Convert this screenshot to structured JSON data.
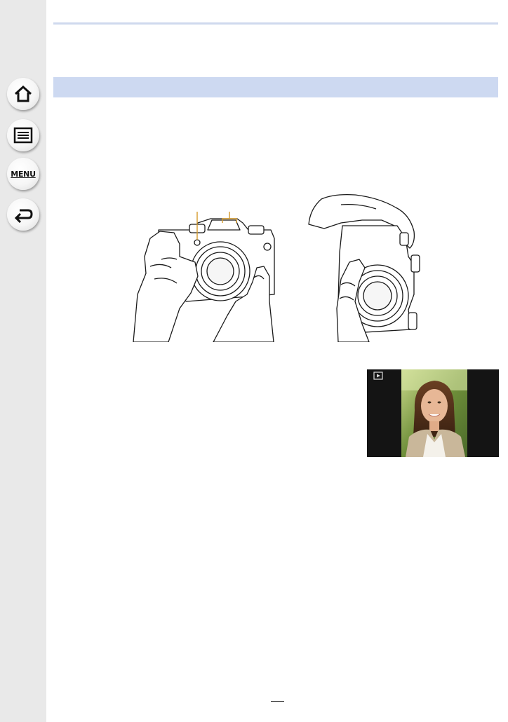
{
  "sidebar": {
    "buttons": [
      {
        "id": "home",
        "icon": "home-icon"
      },
      {
        "id": "contents",
        "icon": "list-icon"
      },
      {
        "id": "menu",
        "icon": "menu-icon",
        "label": "MENU"
      },
      {
        "id": "back",
        "icon": "back-arrow-icon"
      }
    ]
  },
  "colors": {
    "sidebar_bg": "#e9e9e9",
    "section_bar": "#cdd9f1",
    "top_rule": "#cfd9ee",
    "callout": "#d49a2a"
  },
  "illustrations": [
    {
      "name": "camera-held-horizontal",
      "icon": "hands-holding-camera-illustration"
    },
    {
      "name": "camera-held-vertical",
      "icon": "hands-holding-camera-vertical-illustration"
    }
  ],
  "screen": {
    "icon": "playback-icon"
  }
}
